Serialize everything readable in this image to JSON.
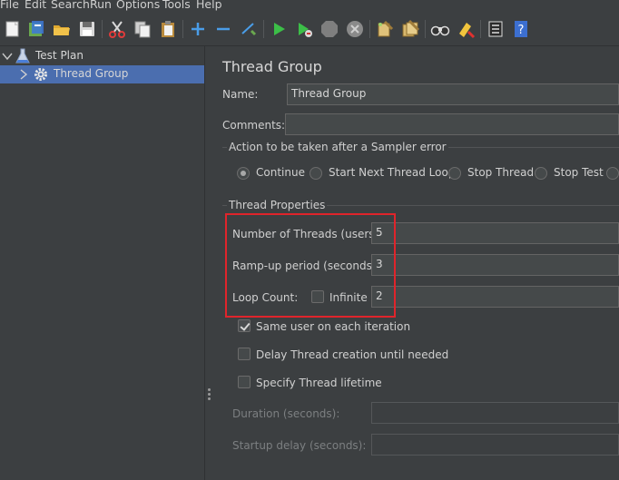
{
  "menu": [
    "File",
    "Edit",
    "Search",
    "Run",
    "Options",
    "Tools",
    "Help"
  ],
  "toolbar": {
    "icons": [
      "new-icon",
      "templates-icon",
      "open-icon",
      "save-icon",
      "cut-icon",
      "copy-icon",
      "paste-icon",
      "expand-icon",
      "collapse-icon",
      "toggle-icon",
      "start-icon",
      "start-no-pause-icon",
      "stop-icon",
      "shutdown-icon",
      "clear-icon",
      "clear-all-icon",
      "search-icon",
      "reset-search-icon",
      "function-helper-icon",
      "help-icon"
    ]
  },
  "tree": {
    "root": "Test Plan",
    "child": "Thread Group"
  },
  "panel": {
    "title": "Thread Group",
    "name_label": "Name:",
    "name_value": "Thread Group",
    "comments_label": "Comments:",
    "comments_value": "",
    "error_action_title": "Action to be taken after a Sampler error",
    "error_actions": [
      "Continue",
      "Start Next Thread Loop",
      "Stop Thread",
      "Stop Test"
    ],
    "error_action_selected": "Continue",
    "thread_props_title": "Thread Properties",
    "threads_label": "Number of Threads (users):",
    "threads_value": "5",
    "rampup_label": "Ramp-up period (seconds):",
    "rampup_value": "3",
    "loop_label": "Loop Count:",
    "infinite_label": "Infinite",
    "infinite_checked": false,
    "loop_value": "2",
    "same_user_label": "Same user on each iteration",
    "same_user_checked": true,
    "delay_label": "Delay Thread creation until needed",
    "delay_checked": false,
    "lifetime_label": "Specify Thread lifetime",
    "lifetime_checked": false,
    "duration_label": "Duration (seconds):",
    "duration_value": "",
    "startup_delay_label": "Startup delay (seconds):",
    "startup_delay_value": ""
  },
  "colors": {
    "background": "#3c3f41",
    "selection": "#4b6eaf",
    "highlight_box": "#e0242b"
  }
}
